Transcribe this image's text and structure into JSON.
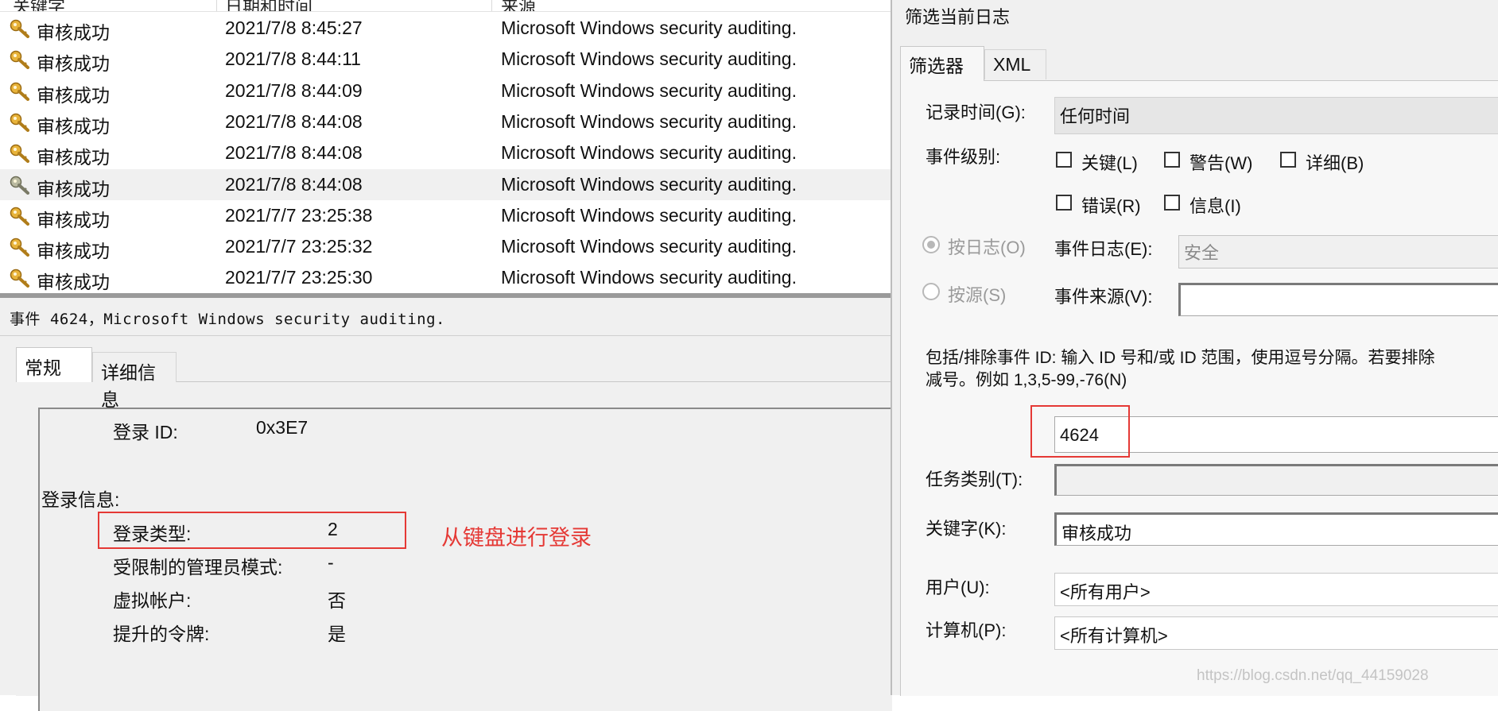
{
  "event_list": {
    "columns": [
      "关键字",
      "日期和时间",
      "来源"
    ],
    "rows": [
      {
        "keyword": "审核成功",
        "datetime": "2021/7/8 8:45:27",
        "source": "Microsoft Windows security auditing.",
        "selected": false
      },
      {
        "keyword": "审核成功",
        "datetime": "2021/7/8 8:44:11",
        "source": "Microsoft Windows security auditing.",
        "selected": false
      },
      {
        "keyword": "审核成功",
        "datetime": "2021/7/8 8:44:09",
        "source": "Microsoft Windows security auditing.",
        "selected": false
      },
      {
        "keyword": "审核成功",
        "datetime": "2021/7/8 8:44:08",
        "source": "Microsoft Windows security auditing.",
        "selected": false
      },
      {
        "keyword": "审核成功",
        "datetime": "2021/7/8 8:44:08",
        "source": "Microsoft Windows security auditing.",
        "selected": false
      },
      {
        "keyword": "审核成功",
        "datetime": "2021/7/8 8:44:08",
        "source": "Microsoft Windows security auditing.",
        "selected": true
      },
      {
        "keyword": "审核成功",
        "datetime": "2021/7/7 23:25:38",
        "source": "Microsoft Windows security auditing.",
        "selected": false
      },
      {
        "keyword": "审核成功",
        "datetime": "2021/7/7 23:25:32",
        "source": "Microsoft Windows security auditing.",
        "selected": false
      },
      {
        "keyword": "审核成功",
        "datetime": "2021/7/7 23:25:30",
        "source": "Microsoft Windows security auditing.",
        "selected": false
      }
    ],
    "row_icon": "key-icon"
  },
  "event_detail": {
    "title": "事件 4624，Microsoft Windows security auditing.",
    "tabs": [
      "常规",
      "详细信息"
    ],
    "logon_id_label": "登录 ID:",
    "logon_id_value": "0x3E7",
    "logon_info_heading": "登录信息:",
    "fields": [
      {
        "label": "登录类型:",
        "value": "2"
      },
      {
        "label": "受限制的管理员模式:",
        "value": "-"
      },
      {
        "label": "虚拟帐户:",
        "value": "否"
      },
      {
        "label": "提升的令牌:",
        "value": "是"
      }
    ],
    "annotation": "从键盘进行登录"
  },
  "filter_dialog": {
    "title": "筛选当前日志",
    "tabs": [
      "筛选器",
      "XML"
    ],
    "logged_label": "记录时间(G):",
    "logged_value": "任何时间",
    "event_level_label": "事件级别:",
    "levels": [
      {
        "label": "关键(L)",
        "checked": false
      },
      {
        "label": "警告(W)",
        "checked": false
      },
      {
        "label": "详细(B)",
        "checked": false
      },
      {
        "label": "错误(R)",
        "checked": false
      },
      {
        "label": "信息(I)",
        "checked": false
      }
    ],
    "by_log_label": "按日志(O)",
    "by_source_label": "按源(S)",
    "by_log_selected": true,
    "event_logs_label": "事件日志(E):",
    "event_logs_value": "安全",
    "event_sources_label": "事件来源(V):",
    "event_sources_value": "",
    "event_id_instructions_1": "包括/排除事件 ID: 输入 ID 号和/或 ID 范围，使用逗号分隔。若要排除",
    "event_id_instructions_2": "减号。例如 1,3,5-99,-76(N)",
    "event_id_value": "4624",
    "task_category_label": "任务类别(T):",
    "task_category_value": "",
    "keywords_label": "关键字(K):",
    "keywords_value": "审核成功",
    "user_label": "用户(U):",
    "user_value": "<所有用户>",
    "computer_label": "计算机(P):",
    "computer_value": "<所有计算机>"
  },
  "watermark": "https://blog.csdn.net/qq_44159028",
  "colors": {
    "annotation_red": "#e53935",
    "selected_row": "#f0f0f0",
    "dialog_bg": "#f0f0f0"
  }
}
